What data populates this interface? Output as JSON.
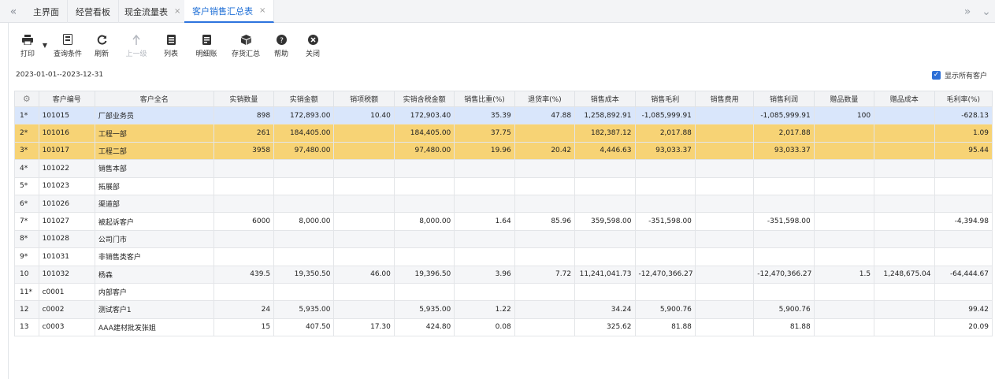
{
  "tabs": {
    "items": [
      {
        "label": "主界面"
      },
      {
        "label": "经营看板"
      },
      {
        "label": "现金流量表",
        "close": "×"
      },
      {
        "label": "客户销售汇总表",
        "close": "×"
      }
    ]
  },
  "toolbar": {
    "print": "打印",
    "query": "查询条件",
    "refresh": "刷新",
    "up": "上一级",
    "list": "列表",
    "detail": "明细账",
    "stock": "存货汇总",
    "help": "帮助",
    "close": "关闭"
  },
  "filter": {
    "date_range": "2023-01-01--2023-12-31",
    "show_all_label": "显示所有客户",
    "show_all_checked": true
  },
  "table": {
    "columns": [
      "客户编号",
      "客户全名",
      "实销数量",
      "实销金额",
      "销项税额",
      "实销含税金额",
      "销售比重(%)",
      "退货率(%)",
      "销售成本",
      "销售毛利",
      "销售费用",
      "销售利润",
      "赠品数量",
      "赠品成本",
      "毛利率(%)"
    ],
    "rows": [
      {
        "idx": "1*",
        "cells": [
          "101015",
          "厂部业务员",
          "898",
          "172,893.00",
          "10.40",
          "172,903.40",
          "35.39",
          "47.88",
          "1,258,892.91",
          "-1,085,999.91",
          "",
          "-1,085,999.91",
          "100",
          "",
          "-628.13"
        ]
      },
      {
        "idx": "2*",
        "cells": [
          "101016",
          "工程一部",
          "261",
          "184,405.00",
          "",
          "184,405.00",
          "37.75",
          "",
          "182,387.12",
          "2,017.88",
          "",
          "2,017.88",
          "",
          "",
          "1.09"
        ]
      },
      {
        "idx": "3*",
        "cells": [
          "101017",
          "工程二部",
          "3958",
          "97,480.00",
          "",
          "97,480.00",
          "19.96",
          "20.42",
          "4,446.63",
          "93,033.37",
          "",
          "93,033.37",
          "",
          "",
          "95.44"
        ]
      },
      {
        "idx": "4*",
        "cells": [
          "101022",
          "销售本部",
          "",
          "",
          "",
          "",
          "",
          "",
          "",
          "",
          "",
          "",
          "",
          "",
          ""
        ]
      },
      {
        "idx": "5*",
        "cells": [
          "101023",
          "拓展部",
          "",
          "",
          "",
          "",
          "",
          "",
          "",
          "",
          "",
          "",
          "",
          "",
          ""
        ]
      },
      {
        "idx": "6*",
        "cells": [
          "101026",
          "渠道部",
          "",
          "",
          "",
          "",
          "",
          "",
          "",
          "",
          "",
          "",
          "",
          "",
          ""
        ]
      },
      {
        "idx": "7*",
        "cells": [
          "101027",
          "被起诉客户",
          "6000",
          "8,000.00",
          "",
          "8,000.00",
          "1.64",
          "85.96",
          "359,598.00",
          "-351,598.00",
          "",
          "-351,598.00",
          "",
          "",
          "-4,394.98"
        ]
      },
      {
        "idx": "8*",
        "cells": [
          "101028",
          "公司门市",
          "",
          "",
          "",
          "",
          "",
          "",
          "",
          "",
          "",
          "",
          "",
          "",
          ""
        ]
      },
      {
        "idx": "9*",
        "cells": [
          "101031",
          "非销售类客户",
          "",
          "",
          "",
          "",
          "",
          "",
          "",
          "",
          "",
          "",
          "",
          "",
          ""
        ]
      },
      {
        "idx": "10",
        "cells": [
          "101032",
          "杨森",
          "439.5",
          "19,350.50",
          "46.00",
          "19,396.50",
          "3.96",
          "7.72",
          "11,241,041.73",
          "-12,470,366.27",
          "",
          "-12,470,366.27",
          "1.5",
          "1,248,675.04",
          "-64,444.67"
        ]
      },
      {
        "idx": "11*",
        "cells": [
          "c0001",
          "内部客户",
          "",
          "",
          "",
          "",
          "",
          "",
          "",
          "",
          "",
          "",
          "",
          "",
          ""
        ]
      },
      {
        "idx": "12",
        "cells": [
          "c0002",
          "测试客户1",
          "24",
          "5,935.00",
          "",
          "5,935.00",
          "1.22",
          "",
          "34.24",
          "5,900.76",
          "",
          "5,900.76",
          "",
          "",
          "99.42"
        ]
      },
      {
        "idx": "13",
        "cells": [
          "c0003",
          "AAA建材批发张姐",
          "15",
          "407.50",
          "17.30",
          "424.80",
          "0.08",
          "",
          "325.62",
          "81.88",
          "",
          "81.88",
          "",
          "",
          "20.09"
        ]
      }
    ]
  },
  "colors": {
    "accent": "#2d74de",
    "selected_row": "#d9e6fb",
    "highlight_row": "#f7d375"
  }
}
